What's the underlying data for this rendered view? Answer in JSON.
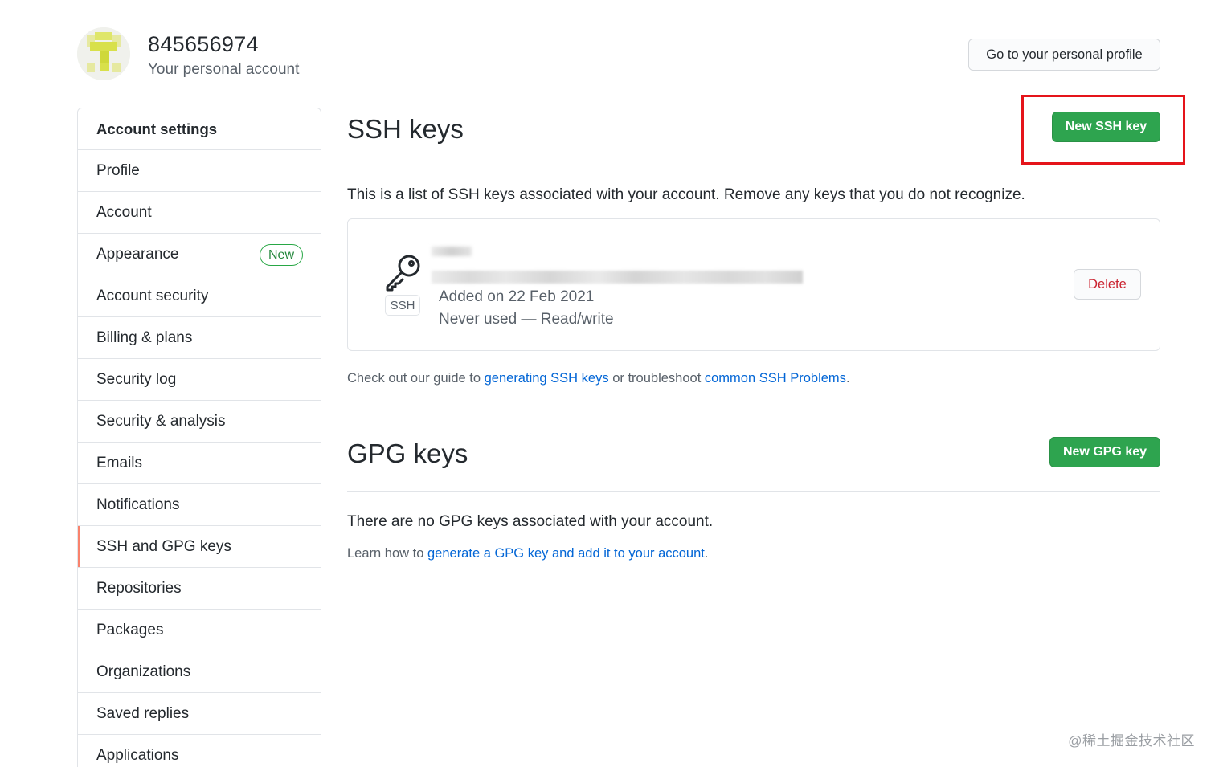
{
  "user": {
    "name": "845656974",
    "subtitle": "Your personal account",
    "profile_button": "Go to your personal profile"
  },
  "sidebar": {
    "items": [
      {
        "label": "Account settings"
      },
      {
        "label": "Profile"
      },
      {
        "label": "Account"
      },
      {
        "label": "Appearance",
        "badge": "New"
      },
      {
        "label": "Account security"
      },
      {
        "label": "Billing & plans"
      },
      {
        "label": "Security log"
      },
      {
        "label": "Security & analysis"
      },
      {
        "label": "Emails"
      },
      {
        "label": "Notifications"
      },
      {
        "label": "SSH and GPG keys",
        "selected": true
      },
      {
        "label": "Repositories"
      },
      {
        "label": "Packages"
      },
      {
        "label": "Organizations"
      },
      {
        "label": "Saved replies"
      },
      {
        "label": "Applications"
      }
    ]
  },
  "ssh": {
    "title": "SSH keys",
    "new_button": "New SSH key",
    "description": "This is a list of SSH keys associated with your account. Remove any keys that you do not recognize.",
    "key": {
      "type_label": "SSH",
      "added": "Added on 22 Feb 2021",
      "usage": "Never used — Read/write",
      "delete_button": "Delete"
    },
    "guide_prefix": "Check out our guide to ",
    "guide_link1": "generating SSH keys",
    "guide_middle": " or troubleshoot ",
    "guide_link2": "common SSH Problems",
    "guide_suffix": "."
  },
  "gpg": {
    "title": "GPG keys",
    "new_button": "New GPG key",
    "empty_text": "There are no GPG keys associated with your account.",
    "learn_prefix": "Learn how to ",
    "learn_link": "generate a GPG key and add it to your account",
    "learn_suffix": "."
  },
  "watermark": "@稀土掘金技术社区",
  "colors": {
    "green": "#2ea44f",
    "link": "#0366d6",
    "selected_bar": "#f9826c",
    "highlight": "#e5141a",
    "danger": "#cb2431"
  }
}
